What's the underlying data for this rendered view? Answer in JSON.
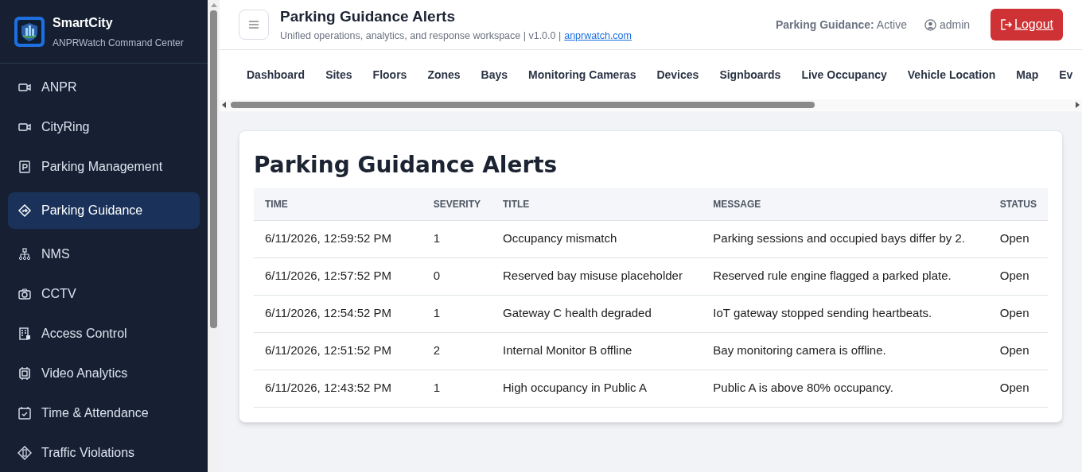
{
  "brand": {
    "name": "SmartCity",
    "subtitle": "ANPRWatch Command Center"
  },
  "sidebar": {
    "items": [
      {
        "label": "ANPR",
        "selected": false
      },
      {
        "label": "CityRing",
        "selected": false
      },
      {
        "label": "Parking Management",
        "selected": false
      },
      {
        "label": "Parking Guidance",
        "selected": true
      },
      {
        "label": "NMS",
        "selected": false
      },
      {
        "label": "CCTV",
        "selected": false
      },
      {
        "label": "Access Control",
        "selected": false
      },
      {
        "label": "Video Analytics",
        "selected": false
      },
      {
        "label": "Time & Attendance",
        "selected": false
      },
      {
        "label": "Traffic Violations",
        "selected": false
      }
    ]
  },
  "header": {
    "title": "Parking Guidance Alerts",
    "subtitle": "Unified operations, analytics, and response workspace | v1.0.0 |",
    "link": "anprwatch.com",
    "status": "**Parking Guidance:** Active",
    "user": "admin",
    "logout": "Logout"
  },
  "tabs": [
    {
      "label": "Dashboard"
    },
    {
      "label": "Sites"
    },
    {
      "label": "Floors"
    },
    {
      "label": "Zones"
    },
    {
      "label": "Bays"
    },
    {
      "label": "Monitoring Cameras"
    },
    {
      "label": "Devices"
    },
    {
      "label": "Signboards"
    },
    {
      "label": "Live Occupancy"
    },
    {
      "label": "Vehicle Location"
    },
    {
      "label": "Map"
    },
    {
      "label": "Ev"
    }
  ],
  "card": {
    "title": "Parking Guidance Alerts",
    "table": {
      "columns": [
        "TIME",
        "SEVERITY",
        "TITLE",
        "MESSAGE",
        "STATUS"
      ],
      "rows": [
        [
          "6/11/2026, 12:59:52 PM",
          "1",
          "Occupancy mismatch",
          "Parking sessions and occupied bays differ by 2.",
          "Open"
        ],
        [
          "6/11/2026, 12:57:52 PM",
          "0",
          "Reserved bay misuse placeholder",
          "Reserved rule engine flagged a parked plate.",
          "Open"
        ],
        [
          "6/11/2026, 12:54:52 PM",
          "1",
          "Gateway C health degraded",
          "IoT gateway stopped sending heartbeats.",
          "Open"
        ],
        [
          "6/11/2026, 12:51:52 PM",
          "2",
          "Internal Monitor B offline",
          "Bay monitoring camera is offline.",
          "Open"
        ],
        [
          "6/11/2026, 12:43:52 PM",
          "1",
          "High occupancy in Public A",
          "Public A is above 80% occupancy.",
          "Open"
        ]
      ]
    }
  }
}
